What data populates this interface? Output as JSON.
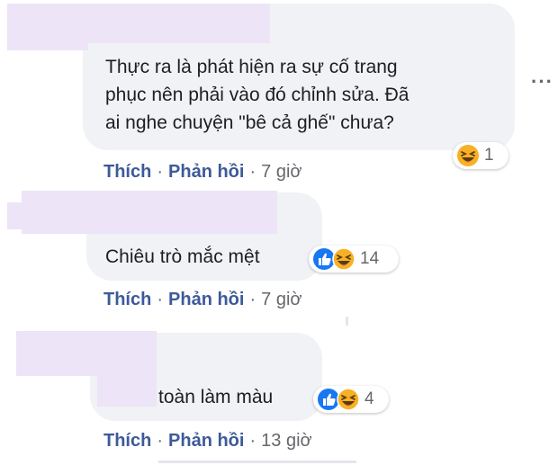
{
  "comments": [
    {
      "text_lines": [
        "Thực ra là phát hiện ra sự cố trang",
        "phục nên phải vào đó chỉnh sửa. Đã",
        "ai nghe chuyện \"bê cả ghế\" chưa?"
      ],
      "reactions": [
        "haha"
      ],
      "reaction_count": "1",
      "like_label": "Thích",
      "reply_label": "Phản hồi",
      "time": "7 giờ"
    },
    {
      "text_lines": [
        "Chiêu trò mắc mệt"
      ],
      "reactions": [
        "like",
        "haha"
      ],
      "reaction_count": "14",
      "like_label": "Thích",
      "reply_label": "Phản hồi",
      "time": "7 giờ"
    },
    {
      "text_lines": [
        "toàn làm màu"
      ],
      "reactions": [
        "like",
        "haha"
      ],
      "reaction_count": "4",
      "like_label": "Thích",
      "reply_label": "Phản hồi",
      "time": "13 giờ"
    }
  ],
  "icons": {
    "more": "more-horizontal-icon",
    "like": "like-reaction-icon",
    "haha": "haha-reaction-icon"
  },
  "colors": {
    "bubble": "#f0f2f5",
    "action_link": "#3d5a99",
    "meta_text": "#65676b",
    "like_blue": "#1877f2",
    "haha_yellow": "#f7b125",
    "redaction": "#ede4f7"
  }
}
